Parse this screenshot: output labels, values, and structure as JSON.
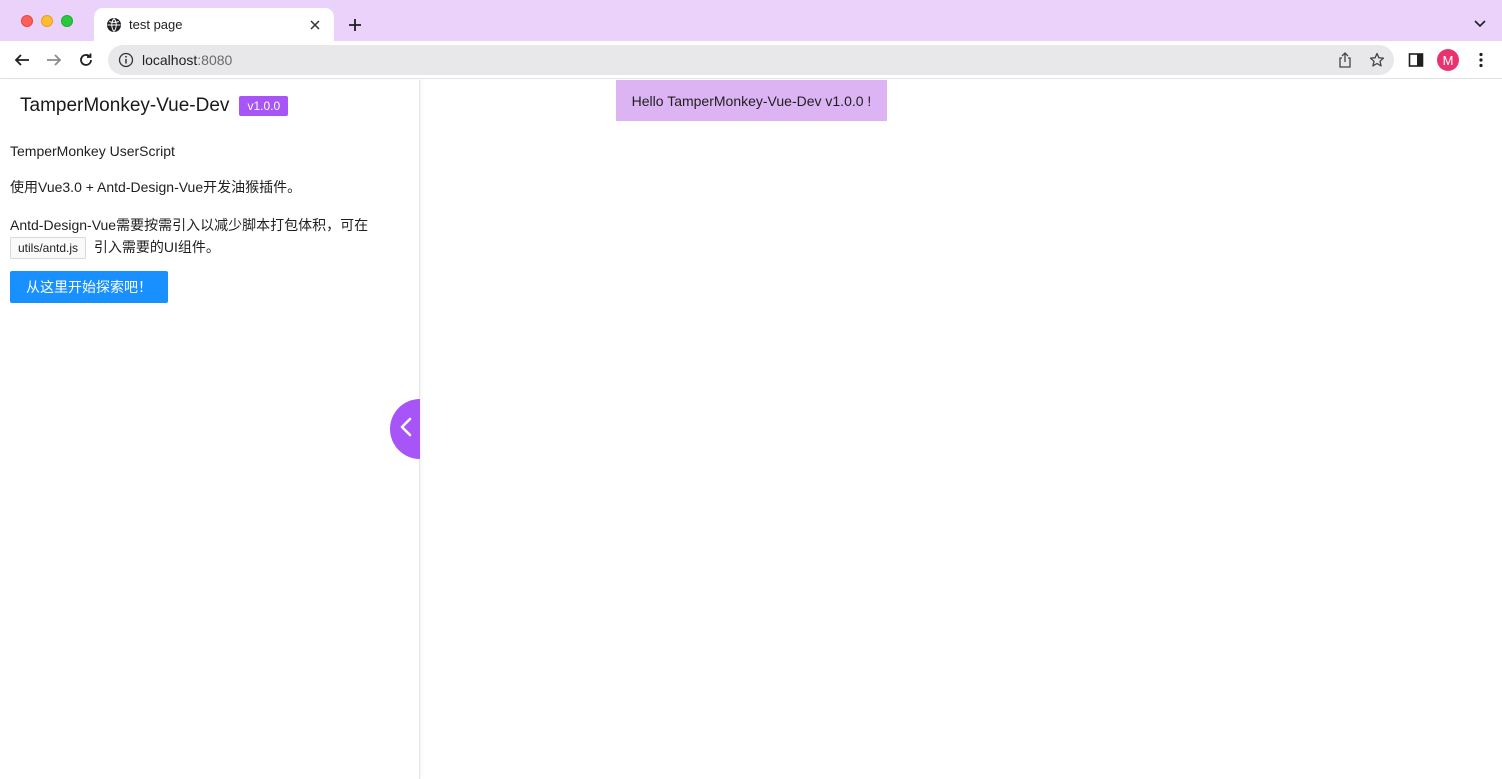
{
  "browser": {
    "tab": {
      "title": "test page",
      "favicon": "globe-icon"
    },
    "address": {
      "host": "localhost",
      "port": ":8080"
    },
    "profile": {
      "initial": "M",
      "color": "#e8336f"
    },
    "titlebar_color": "#ead2fb"
  },
  "sidebar": {
    "title": "TamperMonkey-Vue-Dev",
    "version": "v1.0.0",
    "paragraphs": {
      "p1": "TemperMonkey UserScript",
      "p2": "使用Vue3.0 + Antd-Design-Vue开发油猴插件。",
      "p3_before": "Antd-Design-Vue需要按需引入以减少脚本打包体积，可在",
      "p3_code": "utils/antd.js",
      "p3_after": "引入需要的UI组件。"
    },
    "explore_button": "从这里开始探索吧！",
    "collapse_icon": "chevron-left-icon",
    "accent_color": "#a855f7",
    "button_color": "#1890ff"
  },
  "main": {
    "hello_text": "Hello TamperMonkey-Vue-Dev v1.0.0 !",
    "hello_bg": "#dcb4f4"
  }
}
